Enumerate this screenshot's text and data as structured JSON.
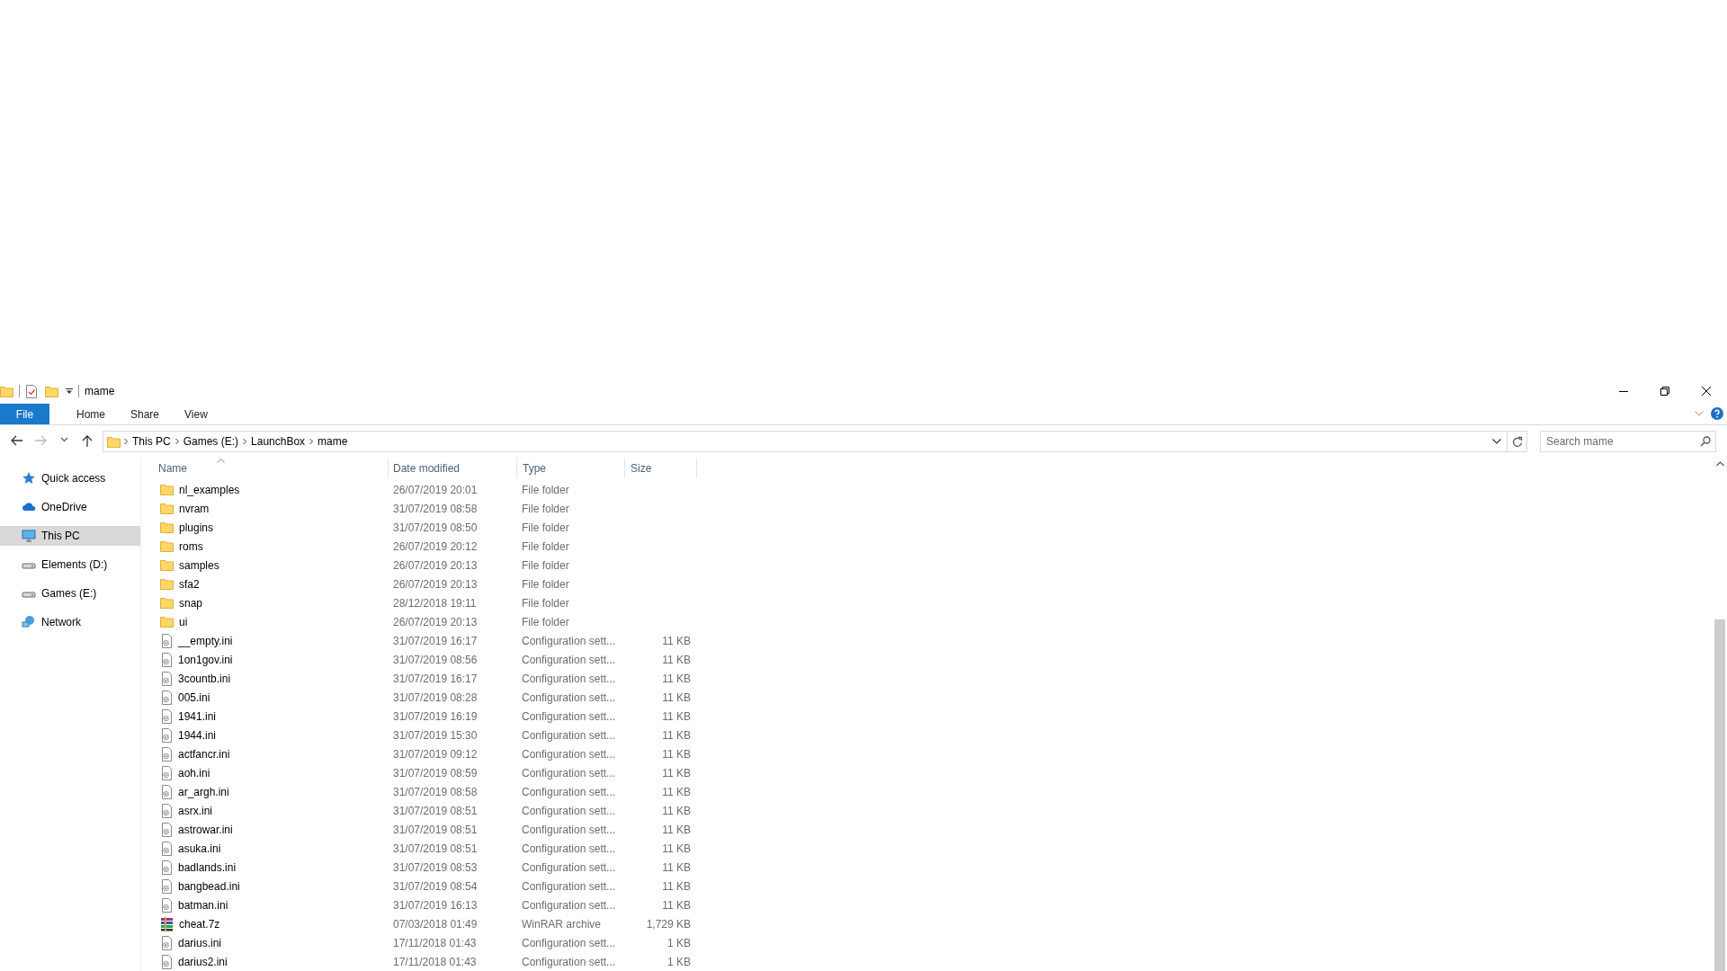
{
  "window": {
    "title": "mame"
  },
  "ribbon_tabs": [
    {
      "label": "File",
      "kind": "file",
      "selected": false
    },
    {
      "label": "Home",
      "kind": "tab",
      "selected": false
    },
    {
      "label": "Share",
      "kind": "tab",
      "selected": false
    },
    {
      "label": "View",
      "kind": "tab",
      "selected": false
    }
  ],
  "address_bar": {
    "crumbs": [
      "This PC",
      "Games (E:)",
      "LaunchBox",
      "mame"
    ]
  },
  "search": {
    "placeholder": "Search mame"
  },
  "sidebar": {
    "items": [
      {
        "label": "Quick access",
        "kind": "star",
        "selected": false
      },
      {
        "label": "OneDrive",
        "kind": "cloud",
        "selected": false
      },
      {
        "label": "This PC",
        "kind": "pc",
        "selected": true
      },
      {
        "label": "Elements (D:)",
        "kind": "drive",
        "selected": false
      },
      {
        "label": "Games (E:)",
        "kind": "drive",
        "selected": false
      },
      {
        "label": "Network",
        "kind": "network",
        "selected": false
      }
    ]
  },
  "table": {
    "columns": [
      "Name",
      "Date modified",
      "Type",
      "Size"
    ],
    "rows": [
      {
        "kind": "folder",
        "name": "nl_examples",
        "date": "26/07/2019 20:01",
        "type": "File folder"
      },
      {
        "kind": "folder",
        "name": "nvram",
        "date": "31/07/2019 08:58",
        "type": "File folder"
      },
      {
        "kind": "folder",
        "name": "plugins",
        "date": "31/07/2019 08:50",
        "type": "File folder"
      },
      {
        "kind": "folder",
        "name": "roms",
        "date": "26/07/2019 20:12",
        "type": "File folder"
      },
      {
        "kind": "folder",
        "name": "samples",
        "date": "26/07/2019 20:13",
        "type": "File folder"
      },
      {
        "kind": "folder",
        "name": "sfa2",
        "date": "26/07/2019 20:13",
        "type": "File folder"
      },
      {
        "kind": "folder",
        "name": "snap",
        "date": "28/12/2018 19:11",
        "type": "File folder"
      },
      {
        "kind": "folder",
        "name": "ui",
        "date": "26/07/2019 20:13",
        "type": "File folder"
      },
      {
        "kind": "config",
        "name": "__empty.ini",
        "date": "31/07/2019 16:17",
        "type": "Configuration sett...",
        "size": "11 KB"
      },
      {
        "kind": "config",
        "name": "1on1gov.ini",
        "date": "31/07/2019 08:56",
        "type": "Configuration sett...",
        "size": "11 KB"
      },
      {
        "kind": "config",
        "name": "3countb.ini",
        "date": "31/07/2019 16:17",
        "type": "Configuration sett...",
        "size": "11 KB"
      },
      {
        "kind": "config",
        "name": "005.ini",
        "date": "31/07/2019 08:28",
        "type": "Configuration sett...",
        "size": "11 KB"
      },
      {
        "kind": "config",
        "name": "1941.ini",
        "date": "31/07/2019 16:19",
        "type": "Configuration sett...",
        "size": "11 KB"
      },
      {
        "kind": "config",
        "name": "1944.ini",
        "date": "31/07/2019 15:30",
        "type": "Configuration sett...",
        "size": "11 KB"
      },
      {
        "kind": "config",
        "name": "actfancr.ini",
        "date": "31/07/2019 09:12",
        "type": "Configuration sett...",
        "size": "11 KB"
      },
      {
        "kind": "config",
        "name": "aoh.ini",
        "date": "31/07/2019 08:59",
        "type": "Configuration sett...",
        "size": "11 KB"
      },
      {
        "kind": "config",
        "name": "ar_argh.ini",
        "date": "31/07/2019 08:58",
        "type": "Configuration sett...",
        "size": "11 KB"
      },
      {
        "kind": "config",
        "name": "asrx.ini",
        "date": "31/07/2019 08:51",
        "type": "Configuration sett...",
        "size": "11 KB"
      },
      {
        "kind": "config",
        "name": "astrowar.ini",
        "date": "31/07/2019 08:51",
        "type": "Configuration sett...",
        "size": "11 KB"
      },
      {
        "kind": "config",
        "name": "asuka.ini",
        "date": "31/07/2019 08:51",
        "type": "Configuration sett...",
        "size": "11 KB"
      },
      {
        "kind": "config",
        "name": "badlands.ini",
        "date": "31/07/2019 08:53",
        "type": "Configuration sett...",
        "size": "11 KB"
      },
      {
        "kind": "config",
        "name": "bangbead.ini",
        "date": "31/07/2019 08:54",
        "type": "Configuration sett...",
        "size": "11 KB"
      },
      {
        "kind": "config",
        "name": "batman.ini",
        "date": "31/07/2019 16:13",
        "type": "Configuration sett...",
        "size": "11 KB"
      },
      {
        "kind": "archive",
        "name": "cheat.7z",
        "date": "07/03/2018 01:49",
        "type": "WinRAR archive",
        "size": "1,729 KB"
      },
      {
        "kind": "config",
        "name": "darius.ini",
        "date": "17/11/2018 01:43",
        "type": "Configuration sett...",
        "size": "1 KB"
      },
      {
        "kind": "config",
        "name": "darius2.ini",
        "date": "17/11/2018 01:43",
        "type": "Configuration sett...",
        "size": "1 KB"
      }
    ]
  }
}
